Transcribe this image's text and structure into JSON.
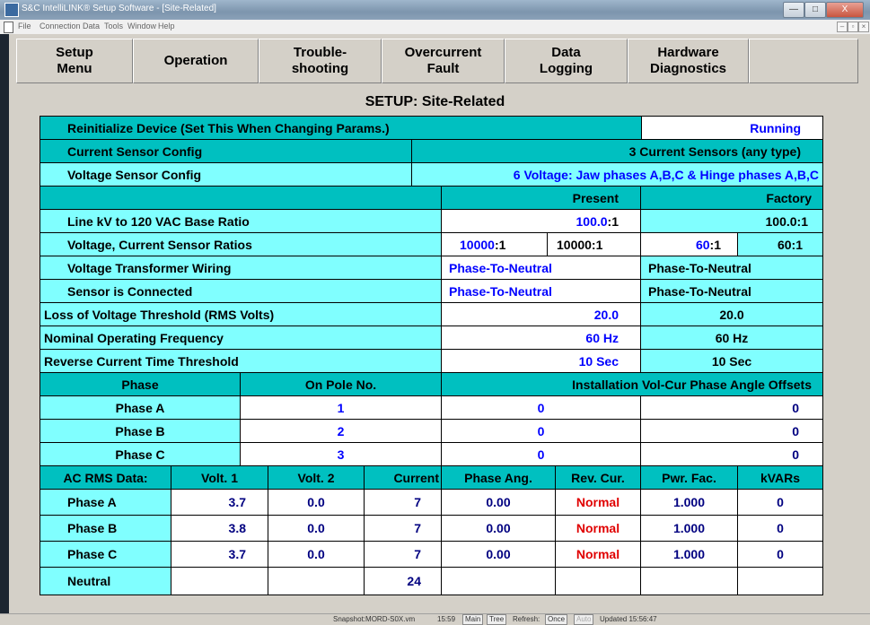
{
  "window": {
    "title": "S&C IntelliLINK® Setup Software - [Site-Related]",
    "minimize": "—",
    "maximize": "□",
    "close": "X"
  },
  "menu": [
    "File",
    "Connection",
    "Data",
    "Tools",
    "Window",
    "Help"
  ],
  "nav": [
    {
      "line1": "Setup",
      "line2": "Menu"
    },
    {
      "line1": "Operation",
      "line2": ""
    },
    {
      "line1": "Trouble-",
      "line2": "shooting"
    },
    {
      "line1": "Overcurrent",
      "line2": "Fault"
    },
    {
      "line1": "Data",
      "line2": "Logging"
    },
    {
      "line1": "Hardware",
      "line2": "Diagnostics"
    },
    {
      "line1": "",
      "line2": ""
    }
  ],
  "page_title": "SETUP: Site-Related",
  "rows": {
    "reinit": {
      "label": "Reinitialize Device (Set This When Changing Params.)",
      "value": "Running"
    },
    "current_cfg": {
      "label": "Current Sensor Config",
      "value": "3 Current Sensors (any type)"
    },
    "voltage_cfg": {
      "label": "Voltage Sensor Config",
      "value": "6 Voltage: Jaw phases A,B,C & Hinge phases A,B,C"
    },
    "headers": {
      "present": "Present",
      "factory": "Factory"
    },
    "line_kv": {
      "label": "Line kV to 120 VAC Base Ratio",
      "present_val": "100.0",
      "present_suffix": ":1",
      "factory": "100.0:1"
    },
    "ratios": {
      "label": "Voltage, Current Sensor Ratios",
      "p1": "10000",
      "p1_suffix": ":1",
      "p2": "10000:1",
      "f1": "60",
      "f1_suffix": ":1",
      "f2": "60:1"
    },
    "vt_wiring": {
      "label": "Voltage Transformer Wiring",
      "present": "Phase-To-Neutral",
      "factory": "Phase-To-Neutral"
    },
    "sensor_conn": {
      "label": "Sensor is Connected",
      "present": "Phase-To-Neutral",
      "factory": "Phase-To-Neutral"
    },
    "lov": {
      "label": "Loss of Voltage Threshold (RMS Volts)",
      "present": "20.0",
      "factory": "20.0"
    },
    "freq": {
      "label": "Nominal Operating Frequency",
      "present": "60 Hz",
      "factory": "60 Hz"
    },
    "revcur": {
      "label": "Reverse Current Time Threshold",
      "present": "10 Sec",
      "factory": "10 Sec"
    }
  },
  "phase_table": {
    "headers": [
      "Phase",
      "On Pole No.",
      "Installation Vol-Cur Phase Angle Offsets"
    ],
    "rows": [
      {
        "phase": "Phase A",
        "pole": "1",
        "off1": "0",
        "off2": "0"
      },
      {
        "phase": "Phase B",
        "pole": "2",
        "off1": "0",
        "off2": "0"
      },
      {
        "phase": "Phase C",
        "pole": "3",
        "off1": "0",
        "off2": "0"
      }
    ]
  },
  "ac_table": {
    "headers": [
      "AC RMS Data:",
      "Volt. 1",
      "Volt. 2",
      "Current",
      "Phase Ang.",
      "Rev. Cur.",
      "Pwr. Fac.",
      "kVARs"
    ],
    "rows": [
      {
        "name": "Phase A",
        "v1": "3.7",
        "v2": "0.0",
        "cur": "7",
        "ang": "0.00",
        "rev": "Normal",
        "pf": "1.000",
        "kvar": "0"
      },
      {
        "name": "Phase B",
        "v1": "3.8",
        "v2": "0.0",
        "cur": "7",
        "ang": "0.00",
        "rev": "Normal",
        "pf": "1.000",
        "kvar": "0"
      },
      {
        "name": "Phase C",
        "v1": "3.7",
        "v2": "0.0",
        "cur": "7",
        "ang": "0.00",
        "rev": "Normal",
        "pf": "1.000",
        "kvar": "0"
      },
      {
        "name": "Neutral",
        "v1": "",
        "v2": "",
        "cur": "24",
        "ang": "",
        "rev": "",
        "pf": "",
        "kvar": ""
      }
    ]
  },
  "status": {
    "snapshot": "Snapshot:MORD-S0X.vm",
    "time": "15:59",
    "main": "Main",
    "tree": "Tree",
    "refresh_label": "Refresh:",
    "once": "Once",
    "auto": "Auto",
    "updated": "Updated 15:56:47"
  }
}
